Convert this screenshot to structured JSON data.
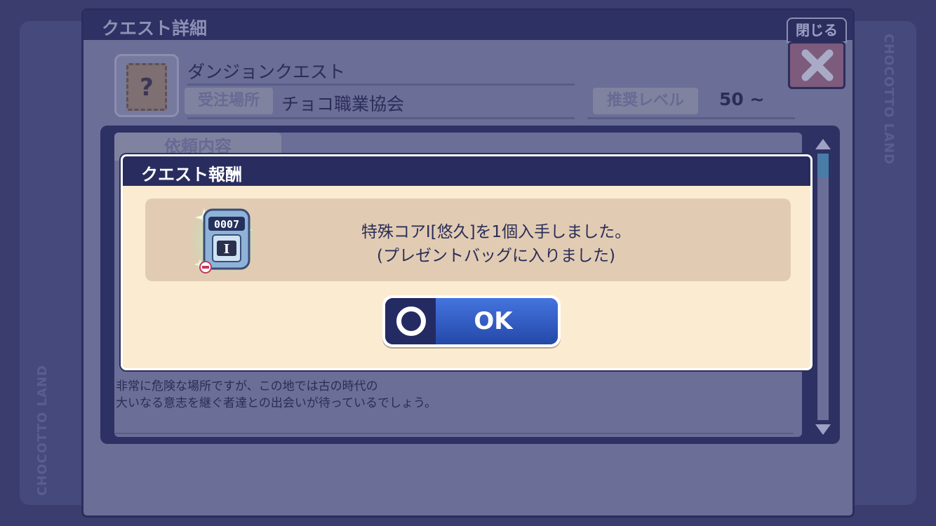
{
  "background": {
    "watermark": "CHOCOTTO LAND"
  },
  "quest_window": {
    "title": "クエスト詳細",
    "close_label": "閉じる",
    "quest_type": "ダンジョンクエスト",
    "location_tag": "受注場所",
    "location": "チョコ職業協会",
    "level_tag": "推奨レベル",
    "level": "50 ~",
    "icon_glyph": "?",
    "content_tab": "依頼内容",
    "description_line1": "非常に危険な場所ですが、この地では古の時代の",
    "description_line2": "大いなる意志を継ぐ者達との出会いが待っているでしょう。"
  },
  "reward_dialog": {
    "title": "クエスト報酬",
    "item_code": "0007",
    "item_mark": "I",
    "message_line1": "特殊コアⅠ[悠久]を1個入手しました。",
    "message_line2": "(プレゼントバッグに入りました)",
    "ok_label": "OK"
  },
  "colors": {
    "dialog_bg": "#fbebd1",
    "titlebar": "#292c5e",
    "ok_button": "#2c4fb0",
    "overlay_bg": "#6b6e96"
  },
  "icons": [
    "question-card-icon",
    "close-x-icon",
    "scroll-up-icon",
    "scroll-down-icon",
    "core-item-icon",
    "circle-button-icon"
  ]
}
